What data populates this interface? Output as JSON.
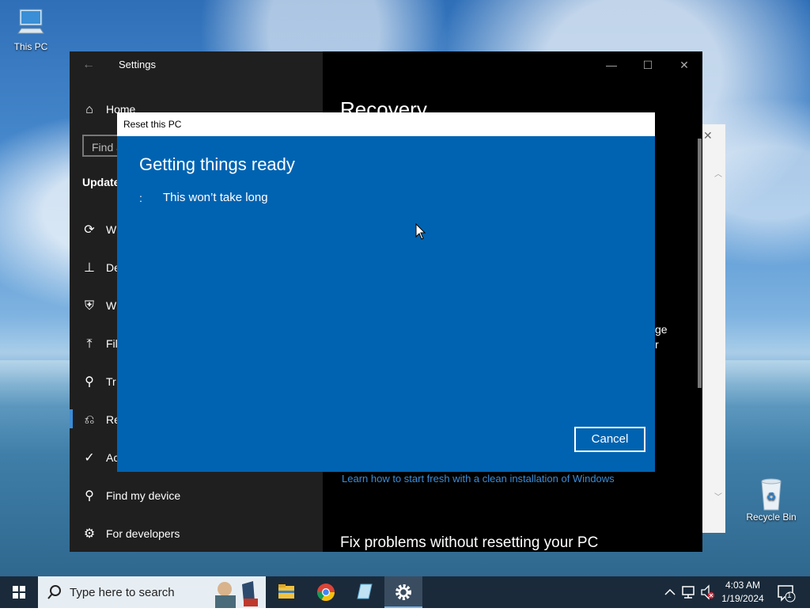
{
  "desktop": {
    "icons": [
      {
        "label": "This PC"
      },
      {
        "label": "Recycle Bin"
      }
    ]
  },
  "settings": {
    "title": "Settings",
    "search_placeholder": "Find a",
    "section_heading": "Update",
    "nav": {
      "home": "Home",
      "windows_update": "W",
      "delivery": "De",
      "windows_security": "W",
      "file_backup": "Fil",
      "troubleshoot": "Tr",
      "recovery": "Re",
      "activation": "Ac",
      "find_my_device": "Find my device",
      "for_developers": "For developers"
    },
    "content": {
      "heading": "Recovery",
      "partial_line1": "ge",
      "partial_line2": "r",
      "link": "Learn how to start fresh with a clean installation of Windows",
      "subheading": "Fix problems without resetting your PC"
    }
  },
  "dialog": {
    "title": "Reset this PC",
    "heading": "Getting things ready",
    "spinner": ":",
    "message": "This won’t take long",
    "cancel_label": "Cancel"
  },
  "taskbar": {
    "search_placeholder": "Type here to search",
    "time": "4:03 AM",
    "date": "1/19/2024",
    "notification_count": "1"
  },
  "colors": {
    "dialog_blue": "#0063b1",
    "link_blue": "#3b8cd6",
    "settings_bg": "#000000"
  }
}
